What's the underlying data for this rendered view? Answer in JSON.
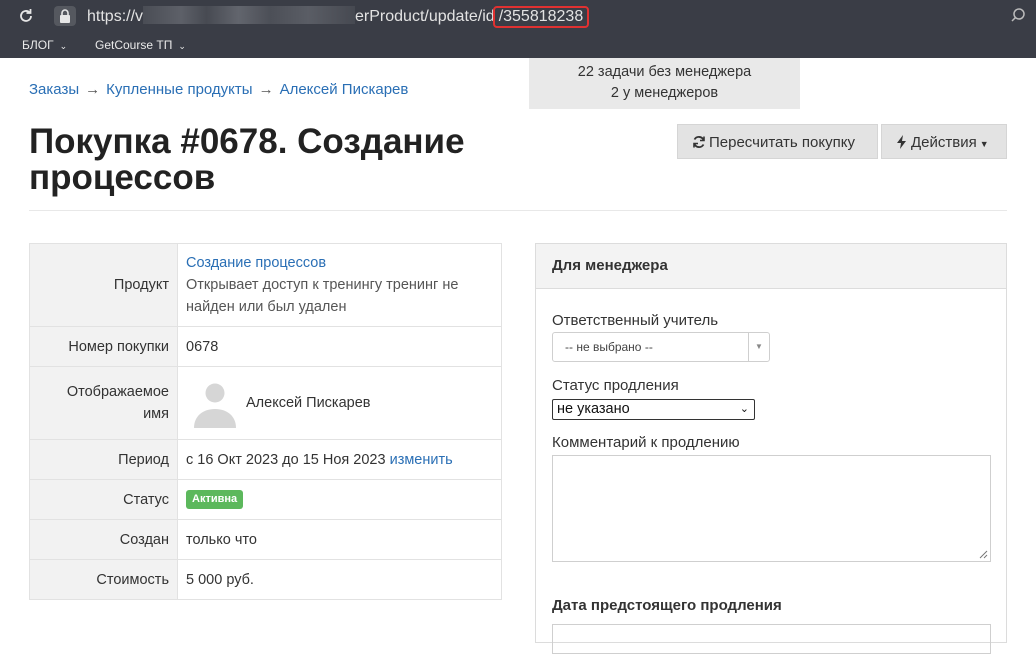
{
  "browser": {
    "url_prefix": "https://v",
    "url_middle": "erProduct/update/id",
    "url_id": "/355818238",
    "bookmarks": [
      {
        "label": "БЛОГ"
      },
      {
        "label": "GetCourse ТП"
      }
    ]
  },
  "breadcrumb": {
    "items": [
      "Заказы",
      "Купленные продукты",
      "Алексей Пискарев"
    ],
    "separator": "→"
  },
  "notice": {
    "line1": "22 задачи без менеджера",
    "line2": "2 у менеджеров"
  },
  "page_title": "Покупка #0678. Создание процессов",
  "actions": {
    "recalc_label": "Пересчитать покупку",
    "actions_label": "Действия"
  },
  "info": {
    "product_label": "Продукт",
    "product_name": "Создание процессов",
    "product_note": "Открывает доступ к тренингу тренинг не найден или был удален",
    "number_label": "Номер покупки",
    "number_value": "0678",
    "display_label": "Отображаемое имя",
    "display_value": "Алексей Пискарев",
    "period_label": "Период",
    "period_value": "с 16 Окт 2023 до 15 Ноя 2023",
    "period_link": "изменить",
    "status_label": "Статус",
    "status_value": "Активна",
    "created_label": "Создан",
    "created_value": "только что",
    "cost_label": "Стоимость",
    "cost_value": "5 000 руб."
  },
  "manager_panel": {
    "title": "Для менеджера",
    "teacher_label": "Ответственный учитель",
    "teacher_value": "-- не выбрано --",
    "renewal_label": "Статус продления",
    "renewal_value": "не указано",
    "comment_label": "Комментарий к продлению",
    "next_renewal_label": "Дата предстоящего продления"
  },
  "colors": {
    "chrome_bg": "#3a3d46",
    "link": "#2a6fb5",
    "badge_green": "#5cb85c",
    "url_highlight_border": "#e03131"
  }
}
